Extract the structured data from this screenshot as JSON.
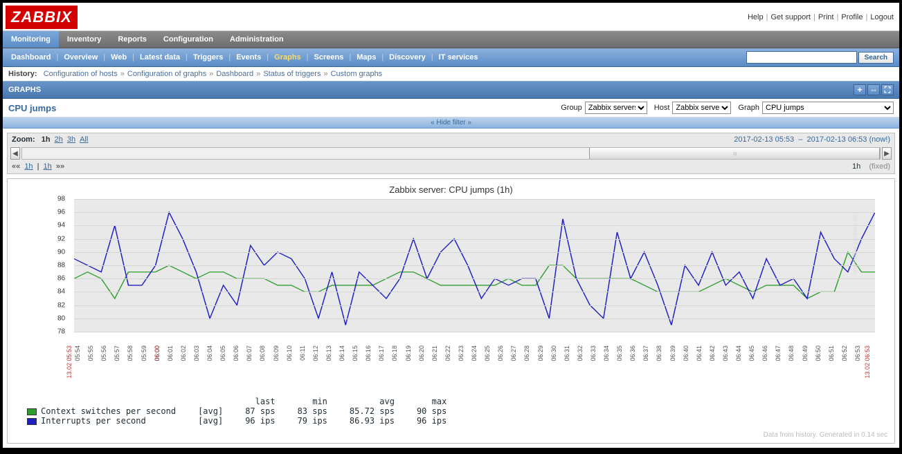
{
  "logo": "ZABBIX",
  "top_links": [
    "Help",
    "Get support",
    "Print",
    "Profile",
    "Logout"
  ],
  "main_nav": [
    "Monitoring",
    "Inventory",
    "Reports",
    "Configuration",
    "Administration"
  ],
  "main_nav_active": 0,
  "sub_nav": [
    "Dashboard",
    "Overview",
    "Web",
    "Latest data",
    "Triggers",
    "Events",
    "Graphs",
    "Screens",
    "Maps",
    "Discovery",
    "IT services"
  ],
  "sub_nav_active": 6,
  "search_btn": "Search",
  "history_label": "History:",
  "history": [
    "Configuration of hosts",
    "Configuration of graphs",
    "Dashboard",
    "Status of triggers",
    "Custom graphs"
  ],
  "section": "GRAPHS",
  "page_title": "CPU jumps",
  "filter": {
    "group_label": "Group",
    "group_value": "Zabbix servers",
    "host_label": "Host",
    "host_value": "Zabbix server",
    "graph_label": "Graph",
    "graph_value": "CPU jumps"
  },
  "hide_filter": "Hide filter",
  "zoom": {
    "label": "Zoom:",
    "levels": [
      "1h",
      "2h",
      "3h",
      "All"
    ],
    "active": 0
  },
  "daterange": {
    "from": "2017-02-13 05:53",
    "sep": "–",
    "to": "2017-02-13 06:53",
    "now": "(now!)"
  },
  "navrow": {
    "back2": "««",
    "back_1h": "1h",
    "sep": "|",
    "fwd_1h": "1h",
    "fwd2": "»»",
    "period": "1h",
    "fixed": "(fixed)"
  },
  "chart_data": {
    "type": "line",
    "title": "Zabbix server: CPU jumps (1h)",
    "ylabel": "",
    "ylim": [
      78,
      98
    ],
    "yticks": [
      78,
      80,
      82,
      84,
      86,
      88,
      90,
      92,
      94,
      96,
      98
    ],
    "x_start_label": "13.02 05:53",
    "x_end_label": "13.02 06:53",
    "x_hour_label": "06:00",
    "x": [
      "05:54",
      "05:55",
      "05:56",
      "05:57",
      "05:58",
      "05:59",
      "06:00",
      "06:01",
      "06:02",
      "06:03",
      "06:04",
      "06:05",
      "06:06",
      "06:07",
      "06:08",
      "06:09",
      "06:10",
      "06:11",
      "06:12",
      "06:13",
      "06:14",
      "06:15",
      "06:16",
      "06:17",
      "06:18",
      "06:19",
      "06:20",
      "06:21",
      "06:22",
      "06:23",
      "06:24",
      "06:25",
      "06:26",
      "06:27",
      "06:28",
      "06:29",
      "06:30",
      "06:31",
      "06:32",
      "06:33",
      "06:34",
      "06:35",
      "06:36",
      "06:37",
      "06:38",
      "06:39",
      "06:40",
      "06:41",
      "06:42",
      "06:43",
      "06:44",
      "06:45",
      "06:46",
      "06:47",
      "06:48",
      "06:49",
      "06:50",
      "06:51",
      "06:52",
      "06:53"
    ],
    "series": [
      {
        "name": "Context switches per second",
        "color": "#2e9e2e",
        "agg": "[avg]",
        "stats": {
          "last": "87 sps",
          "min": "83 sps",
          "avg": "85.72 sps",
          "max": "90 sps"
        },
        "values": [
          86,
          87,
          86,
          83,
          87,
          87,
          87,
          88,
          87,
          86,
          87,
          87,
          86,
          86,
          86,
          85,
          85,
          84,
          84,
          85,
          85,
          85,
          85,
          86,
          87,
          87,
          86,
          85,
          85,
          85,
          85,
          85,
          86,
          85,
          85,
          88,
          88,
          86,
          86,
          86,
          86,
          86,
          85,
          84,
          84,
          84,
          84,
          85,
          86,
          85,
          84,
          85,
          85,
          85,
          83,
          84,
          84,
          90,
          87,
          87
        ]
      },
      {
        "name": "Interrupts per second",
        "color": "#2020c0",
        "agg": "[avg]",
        "stats": {
          "last": "96 ips",
          "min": "79 ips",
          "avg": "86.93 ips",
          "max": "96 ips"
        },
        "values": [
          89,
          88,
          87,
          94,
          85,
          85,
          88,
          96,
          92,
          87,
          80,
          85,
          82,
          91,
          88,
          90,
          89,
          86,
          80,
          87,
          79,
          87,
          85,
          83,
          86,
          92,
          86,
          90,
          92,
          88,
          83,
          86,
          85,
          86,
          86,
          80,
          95,
          86,
          82,
          80,
          93,
          86,
          90,
          85,
          79,
          88,
          85,
          90,
          85,
          87,
          83,
          89,
          85,
          86,
          83,
          93,
          89,
          87,
          92,
          96
        ]
      }
    ]
  },
  "legend_headers": [
    "last",
    "min",
    "avg",
    "max"
  ],
  "footer": "Data from history. Generated in 0.14 sec",
  "watermark": "http://www.zabbix.com"
}
